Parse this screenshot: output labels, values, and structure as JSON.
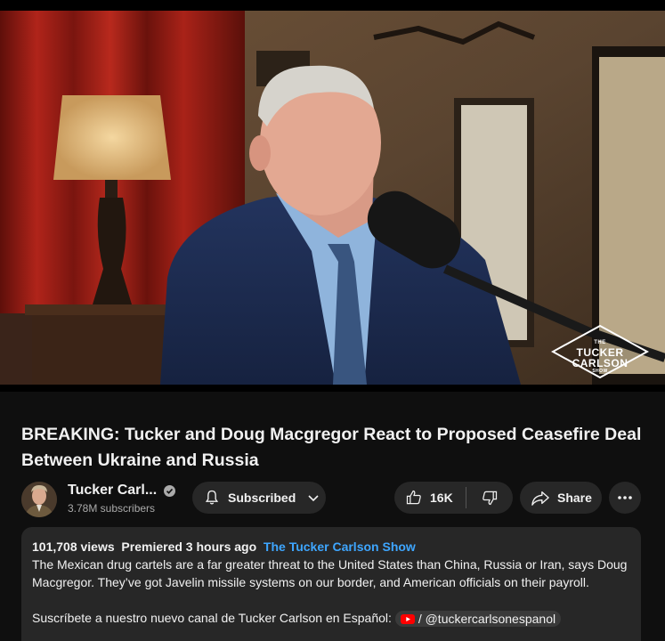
{
  "video": {
    "watermark_line1": "THE",
    "watermark_line2": "TUCKER",
    "watermark_line3": "CARLSON",
    "watermark_line4": "SHOW"
  },
  "title": "BREAKING: Tucker and Doug Macgregor React to Proposed Ceasefire Deal Between Ukraine and Russia",
  "channel": {
    "name": "Tucker Carl...",
    "subscribers": "3.78M subscribers",
    "avatar_icon": "channel-avatar",
    "verified_icon": "verified-check-icon"
  },
  "actions": {
    "subscribe_label": "Subscribed",
    "likes_count": "16K",
    "share_label": "Share"
  },
  "description": {
    "views": "101,708 views",
    "premiered": "Premiered 3 hours ago",
    "channel_tag": "The Tucker Carlson Show",
    "body": "The Mexican drug cartels are a far greater threat to the United States than China, Russia or Iran, says Doug Macgregor. They’ve got Javelin missile systems on our border, and American officials on their payroll.",
    "spanish_prompt": "Suscríbete a nuestro nuevo canal de Tucker Carlson en Español:",
    "handle": "/ @tuckercarlsonespanol"
  },
  "colors": {
    "background": "#0f0f0f",
    "pill": "#272727",
    "link": "#3ea6ff",
    "youtube_red": "#ff0000"
  }
}
